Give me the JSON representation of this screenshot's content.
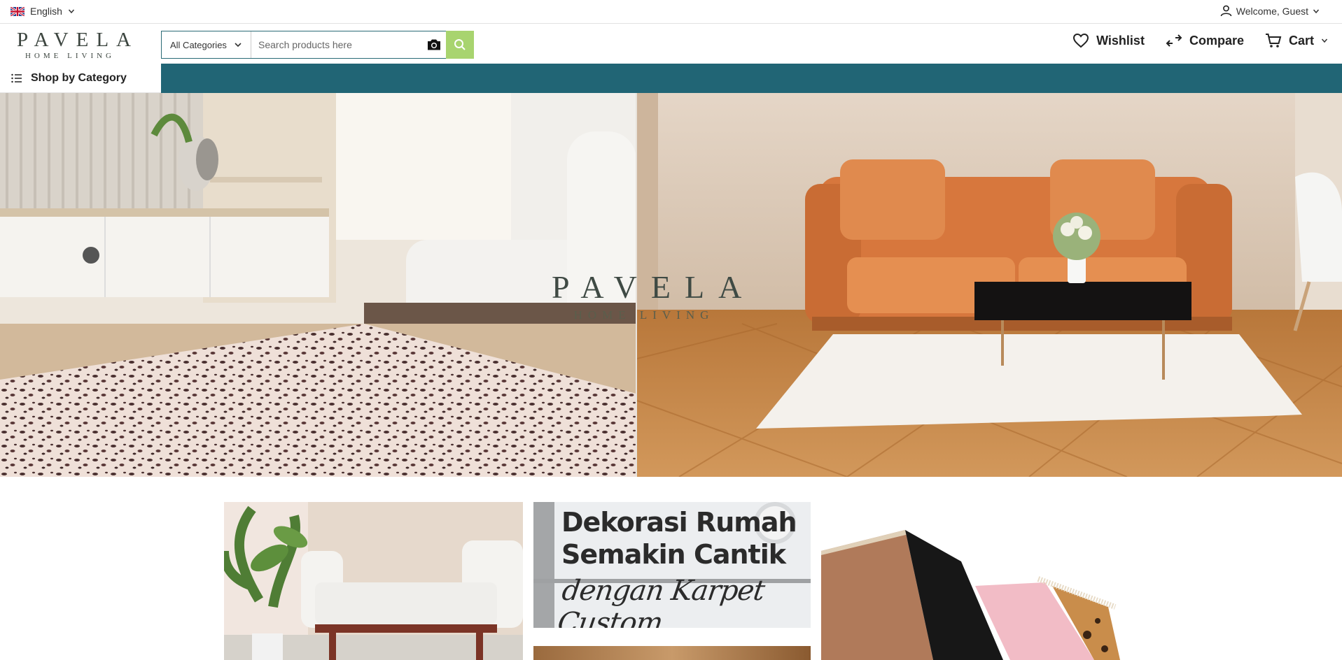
{
  "topbar": {
    "language": "English",
    "welcome": "Welcome, Guest"
  },
  "header": {
    "logo_main": "PAVELA",
    "logo_sub": "HOME LIVING",
    "search": {
      "category": "All Categories",
      "placeholder": "Search products here"
    },
    "actions": {
      "wishlist": "Wishlist",
      "compare": "Compare",
      "cart": "Cart"
    }
  },
  "nav": {
    "shop_by_category": "Shop by Category"
  },
  "hero": {
    "logo_main": "PAVELA",
    "logo_sub": "HOME LIVING"
  },
  "promos": {
    "banner2_line1": "Dekorasi Rumah",
    "banner2_line2": "Semakin Cantik",
    "banner2_script": "dengan Karpet Custom"
  },
  "colors": {
    "nav_bg": "#216575",
    "search_button": "#a8d46f",
    "logo": "#3d4640"
  }
}
